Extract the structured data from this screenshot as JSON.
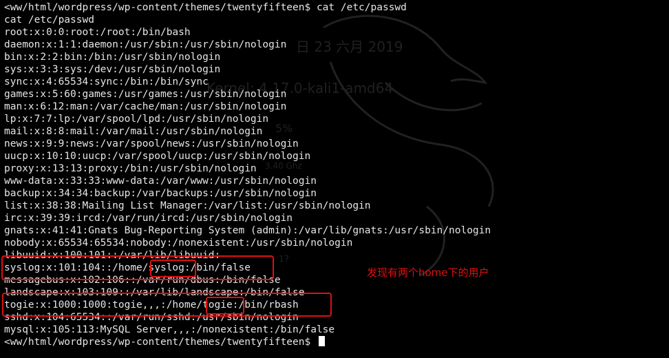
{
  "terminal": {
    "prompt_top": "<ww/html/wordpress/wp-content/themes/twentyfifteen$ cat /etc/passwd",
    "echo": "cat /etc/passwd",
    "passwd_lines": [
      "root:x:0:0:root:/root:/bin/bash",
      "daemon:x:1:1:daemon:/usr/sbin:/usr/sbin/nologin",
      "bin:x:2:2:bin:/bin:/usr/sbin/nologin",
      "sys:x:3:3:sys:/dev:/usr/sbin/nologin",
      "sync:x:4:65534:sync:/bin:/bin/sync",
      "games:x:5:60:games:/usr/games:/usr/sbin/nologin",
      "man:x:6:12:man:/var/cache/man:/usr/sbin/nologin",
      "lp:x:7:7:lp:/var/spool/lpd:/usr/sbin/nologin",
      "mail:x:8:8:mail:/var/mail:/usr/sbin/nologin",
      "news:x:9:9:news:/var/spool/news:/usr/sbin/nologin",
      "uucp:x:10:10:uucp:/var/spool/uucp:/usr/sbin/nologin",
      "proxy:x:13:13:proxy:/bin:/usr/sbin/nologin",
      "www-data:x:33:33:www-data:/var/www:/usr/sbin/nologin",
      "backup:x:34:34:backup:/var/backups:/usr/sbin/nologin",
      "list:x:38:38:Mailing List Manager:/var/list:/usr/sbin/nologin",
      "irc:x:39:39:ircd:/var/run/ircd:/usr/sbin/nologin",
      "gnats:x:41:41:Gnats Bug-Reporting System (admin):/var/lib/gnats:/usr/sbin/nologin",
      "nobody:x:65534:65534:nobody:/nonexistent:/usr/sbin/nologin",
      "libuuid:x:100:101::/var/lib/libuuid:",
      "syslog:x:101:104::/home/syslog:/bin/false",
      "messagebus:x:102:106::/var/run/dbus:/bin/false",
      "landscape:x:103:109::/var/lib/landscape:/bin/false",
      "togie:x:1000:1000:togie,,,:/home/togie:/bin/rbash",
      "sshd:x:104:65534::/var/run/sshd:/usr/sbin/nologin",
      "mysql:x:105:113:MySQL Server,,,:/nonexistent:/bin/false"
    ],
    "prompt_bottom": "<ww/html/wordpress/wp-content/themes/twentyfifteen$"
  },
  "annotation": {
    "note": "发现有两个home下的用户",
    "color": "#e01010"
  },
  "colors": {
    "background": "#000000",
    "text": "#e6e6e6",
    "annotation": "#e01010"
  }
}
